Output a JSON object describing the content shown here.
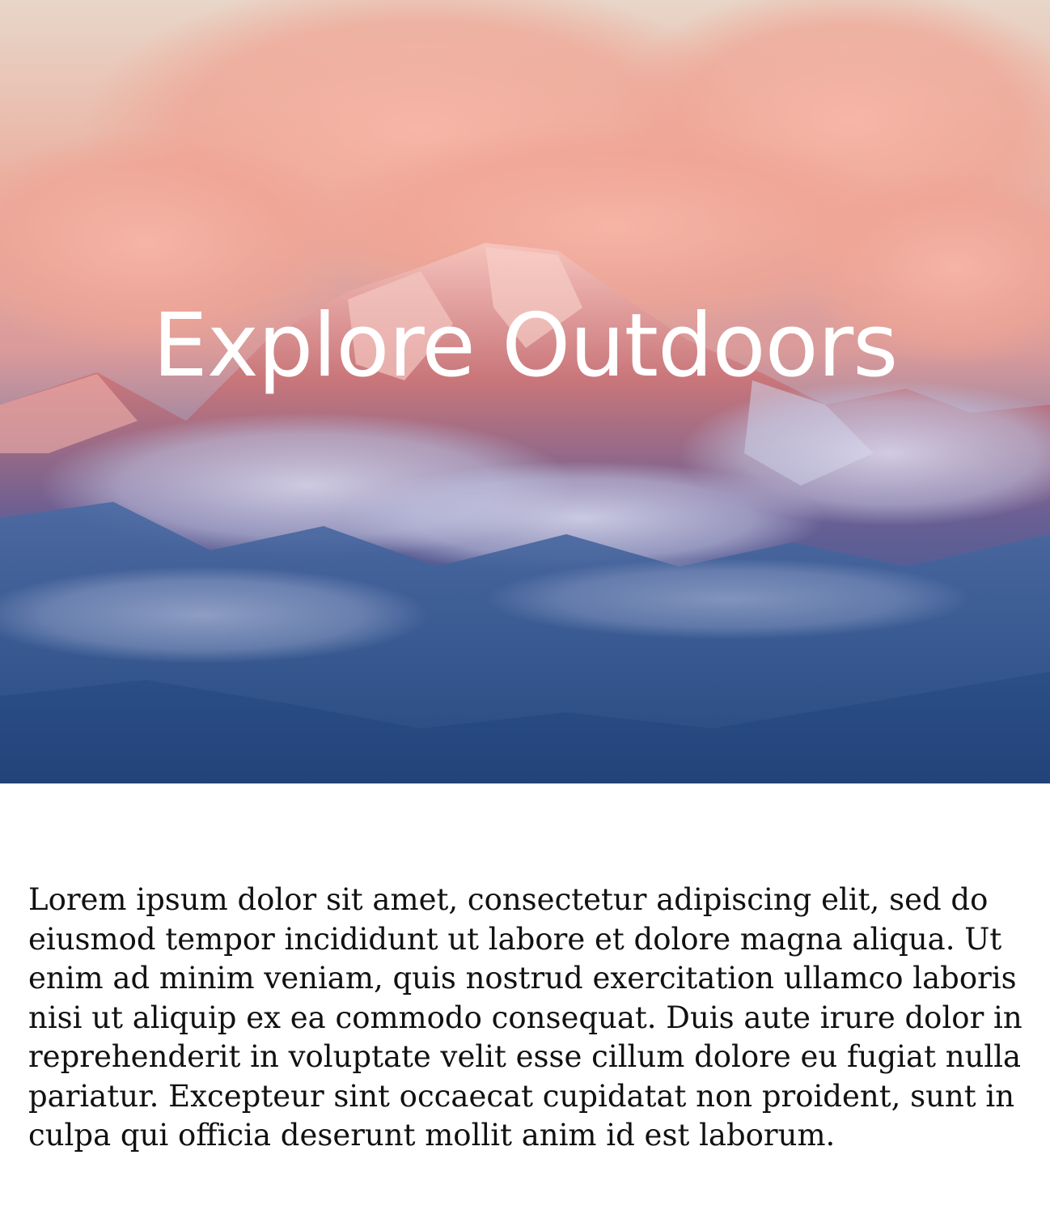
{
  "hero": {
    "title": "Explore Outdoors"
  },
  "content": {
    "paragraph": "Lorem ipsum dolor sit amet, consectetur adipiscing elit, sed do eiusmod tempor incididunt ut labore et dolore magna aliqua. Ut enim ad minim veniam, quis nostrud exercitation ullamco laboris nisi ut aliquip ex ea commodo consequat. Duis aute irure dolor in reprehenderit in voluptate velit esse cillum dolore eu fugiat nulla pariatur. Excepteur sint occaecat cupidatat non proident, sunt in culpa qui officia deserunt mollit anim id est laborum."
  },
  "colors": {
    "sky_top": "#e9d4c4",
    "cloud_pink": "#f2a99b",
    "mountain_blue": "#2f5a95",
    "deep_blue": "#23467f",
    "text": "#111111",
    "title": "#ffffff"
  }
}
